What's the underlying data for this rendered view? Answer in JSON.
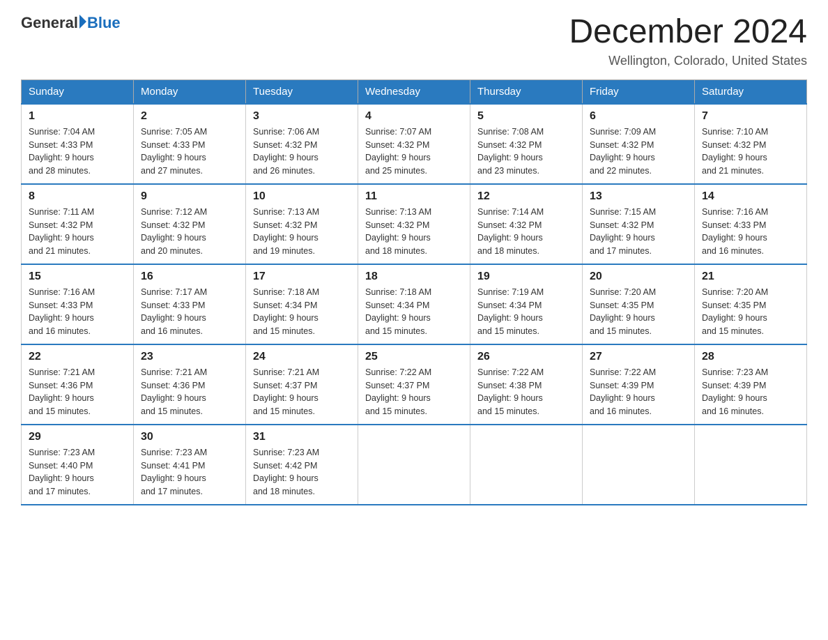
{
  "header": {
    "logo_general": "General",
    "logo_blue": "Blue",
    "month_title": "December 2024",
    "location": "Wellington, Colorado, United States"
  },
  "days_of_week": [
    "Sunday",
    "Monday",
    "Tuesday",
    "Wednesday",
    "Thursday",
    "Friday",
    "Saturday"
  ],
  "weeks": [
    [
      {
        "day": "1",
        "sunrise": "7:04 AM",
        "sunset": "4:33 PM",
        "daylight": "9 hours and 28 minutes."
      },
      {
        "day": "2",
        "sunrise": "7:05 AM",
        "sunset": "4:33 PM",
        "daylight": "9 hours and 27 minutes."
      },
      {
        "day": "3",
        "sunrise": "7:06 AM",
        "sunset": "4:32 PM",
        "daylight": "9 hours and 26 minutes."
      },
      {
        "day": "4",
        "sunrise": "7:07 AM",
        "sunset": "4:32 PM",
        "daylight": "9 hours and 25 minutes."
      },
      {
        "day": "5",
        "sunrise": "7:08 AM",
        "sunset": "4:32 PM",
        "daylight": "9 hours and 23 minutes."
      },
      {
        "day": "6",
        "sunrise": "7:09 AM",
        "sunset": "4:32 PM",
        "daylight": "9 hours and 22 minutes."
      },
      {
        "day": "7",
        "sunrise": "7:10 AM",
        "sunset": "4:32 PM",
        "daylight": "9 hours and 21 minutes."
      }
    ],
    [
      {
        "day": "8",
        "sunrise": "7:11 AM",
        "sunset": "4:32 PM",
        "daylight": "9 hours and 21 minutes."
      },
      {
        "day": "9",
        "sunrise": "7:12 AM",
        "sunset": "4:32 PM",
        "daylight": "9 hours and 20 minutes."
      },
      {
        "day": "10",
        "sunrise": "7:13 AM",
        "sunset": "4:32 PM",
        "daylight": "9 hours and 19 minutes."
      },
      {
        "day": "11",
        "sunrise": "7:13 AM",
        "sunset": "4:32 PM",
        "daylight": "9 hours and 18 minutes."
      },
      {
        "day": "12",
        "sunrise": "7:14 AM",
        "sunset": "4:32 PM",
        "daylight": "9 hours and 18 minutes."
      },
      {
        "day": "13",
        "sunrise": "7:15 AM",
        "sunset": "4:32 PM",
        "daylight": "9 hours and 17 minutes."
      },
      {
        "day": "14",
        "sunrise": "7:16 AM",
        "sunset": "4:33 PM",
        "daylight": "9 hours and 16 minutes."
      }
    ],
    [
      {
        "day": "15",
        "sunrise": "7:16 AM",
        "sunset": "4:33 PM",
        "daylight": "9 hours and 16 minutes."
      },
      {
        "day": "16",
        "sunrise": "7:17 AM",
        "sunset": "4:33 PM",
        "daylight": "9 hours and 16 minutes."
      },
      {
        "day": "17",
        "sunrise": "7:18 AM",
        "sunset": "4:34 PM",
        "daylight": "9 hours and 15 minutes."
      },
      {
        "day": "18",
        "sunrise": "7:18 AM",
        "sunset": "4:34 PM",
        "daylight": "9 hours and 15 minutes."
      },
      {
        "day": "19",
        "sunrise": "7:19 AM",
        "sunset": "4:34 PM",
        "daylight": "9 hours and 15 minutes."
      },
      {
        "day": "20",
        "sunrise": "7:20 AM",
        "sunset": "4:35 PM",
        "daylight": "9 hours and 15 minutes."
      },
      {
        "day": "21",
        "sunrise": "7:20 AM",
        "sunset": "4:35 PM",
        "daylight": "9 hours and 15 minutes."
      }
    ],
    [
      {
        "day": "22",
        "sunrise": "7:21 AM",
        "sunset": "4:36 PM",
        "daylight": "9 hours and 15 minutes."
      },
      {
        "day": "23",
        "sunrise": "7:21 AM",
        "sunset": "4:36 PM",
        "daylight": "9 hours and 15 minutes."
      },
      {
        "day": "24",
        "sunrise": "7:21 AM",
        "sunset": "4:37 PM",
        "daylight": "9 hours and 15 minutes."
      },
      {
        "day": "25",
        "sunrise": "7:22 AM",
        "sunset": "4:37 PM",
        "daylight": "9 hours and 15 minutes."
      },
      {
        "day": "26",
        "sunrise": "7:22 AM",
        "sunset": "4:38 PM",
        "daylight": "9 hours and 15 minutes."
      },
      {
        "day": "27",
        "sunrise": "7:22 AM",
        "sunset": "4:39 PM",
        "daylight": "9 hours and 16 minutes."
      },
      {
        "day": "28",
        "sunrise": "7:23 AM",
        "sunset": "4:39 PM",
        "daylight": "9 hours and 16 minutes."
      }
    ],
    [
      {
        "day": "29",
        "sunrise": "7:23 AM",
        "sunset": "4:40 PM",
        "daylight": "9 hours and 17 minutes."
      },
      {
        "day": "30",
        "sunrise": "7:23 AM",
        "sunset": "4:41 PM",
        "daylight": "9 hours and 17 minutes."
      },
      {
        "day": "31",
        "sunrise": "7:23 AM",
        "sunset": "4:42 PM",
        "daylight": "9 hours and 18 minutes."
      },
      null,
      null,
      null,
      null
    ]
  ],
  "labels": {
    "sunrise": "Sunrise:",
    "sunset": "Sunset:",
    "daylight": "Daylight:"
  }
}
